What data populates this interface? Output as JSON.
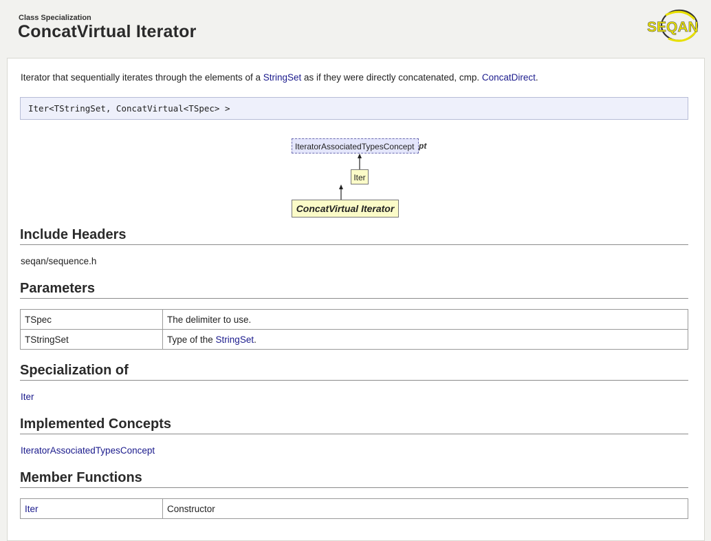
{
  "header": {
    "kicker": "Class Specialization",
    "title": "ConcatVirtual Iterator",
    "logo_text": "SEQAN"
  },
  "intro": {
    "before": "Iterator that sequentially iterates through the elements of a ",
    "link1": "StringSet",
    "middle": " as if they were directly concatenated, cmp. ",
    "link2": "ConcatDirect",
    "after": "."
  },
  "signature": "Iter<TStringSet, ConcatVirtual<TSpec> >",
  "diagram": {
    "concept": "IteratorAssociatedTypesConcept",
    "concept_overflow": "pt",
    "parent": "Iter",
    "self": "ConcatVirtual Iterator"
  },
  "sections": {
    "include_headers": "Include Headers",
    "parameters": "Parameters",
    "specialization_of": "Specialization of",
    "implemented_concepts": "Implemented Concepts",
    "member_functions": "Member Functions"
  },
  "include_header": "seqan/sequence.h",
  "parameters": [
    {
      "name": "TSpec",
      "desc": "The delimiter to use.",
      "desc_link": "",
      "desc_after": ""
    },
    {
      "name": "TStringSet",
      "desc": "Type of the ",
      "desc_link": "StringSet",
      "desc_after": "."
    }
  ],
  "specialization_of": "Iter",
  "implemented_concepts": "IteratorAssociatedTypesConcept",
  "member_functions": [
    {
      "name": "Iter",
      "desc": "Constructor"
    }
  ],
  "colors": {
    "link": "#1a1a8c",
    "signature_bg": "#eef0fb",
    "node_bg": "#fbfbc8",
    "concept_bg": "#e4e6fb",
    "logo_yellow": "#e8e000"
  }
}
